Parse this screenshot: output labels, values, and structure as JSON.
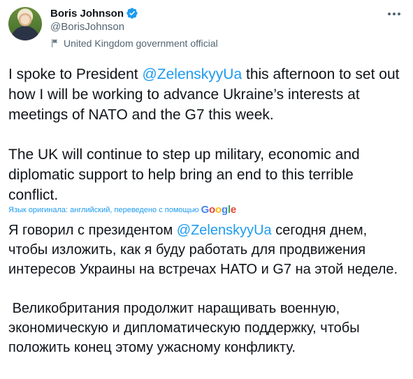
{
  "author": {
    "name": "Boris Johnson",
    "handle": "@BorisJohnson",
    "label": "United Kingdom government official",
    "verified_color": "#1d9bf0"
  },
  "icons": {
    "verified": "verified-badge-icon",
    "flag": "flag-icon",
    "more": "more-options-icon"
  },
  "tweet": {
    "p1": {
      "before": "I spoke to President ",
      "mention": "@ZelenskyyUa",
      "after": " this afternoon to set out how I will be working to advance Ukraine’s interests at meetings of NATO and the G7 this week."
    },
    "p2": "The UK will continue to step up military, economic and diplomatic support to help bring an end to this terrible conflict."
  },
  "translation": {
    "note": "Язык оригинала: английский, переведено с помощью",
    "provider": "Google",
    "p1": {
      "before": "Я говорил с президентом ",
      "mention": "@ZelenskyyUa",
      "after": " сегодня днем, чтобы изложить, как я буду работать для продвижения интересов Украины на встречах НАТО и G7 на этой неделе."
    },
    "p2": " Великобритания продолжит наращивать военную, экономическую и дипломатическую поддержку, чтобы положить конец этому ужасному конфликту."
  },
  "colors": {
    "link": "#1d9bf0",
    "text": "#0f1419",
    "muted": "#536471"
  }
}
